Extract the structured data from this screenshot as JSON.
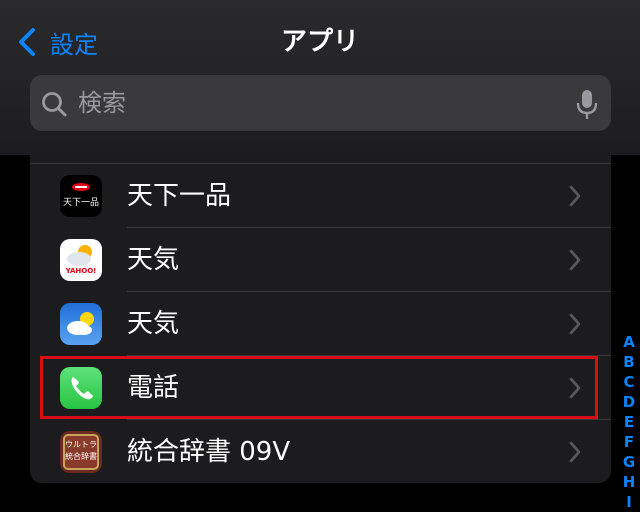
{
  "nav": {
    "back_label": "設定",
    "title": "アプリ"
  },
  "search": {
    "placeholder": "検索"
  },
  "apps": [
    {
      "name": "天下一品",
      "icon": "tenkaippin-app-icon",
      "icon_text": "天下一品"
    },
    {
      "name": "天気",
      "icon": "yahoo-weather-app-icon",
      "icon_text": "YAHOO!"
    },
    {
      "name": "天気",
      "icon": "apple-weather-app-icon"
    },
    {
      "name": "電話",
      "icon": "phone-app-icon",
      "highlighted": true
    },
    {
      "name": "統合辞書 09V",
      "icon": "ultra-dictionary-app-icon",
      "icon_text": "ウルトラ統合辞書"
    }
  ],
  "index_letters": [
    "A",
    "B",
    "C",
    "D",
    "E",
    "F",
    "G",
    "H",
    "I"
  ],
  "colors": {
    "accent": "#0a84ff",
    "highlight": "#d70f12",
    "row_bg": "#1c1c1e",
    "phone_green": "#34c759"
  }
}
